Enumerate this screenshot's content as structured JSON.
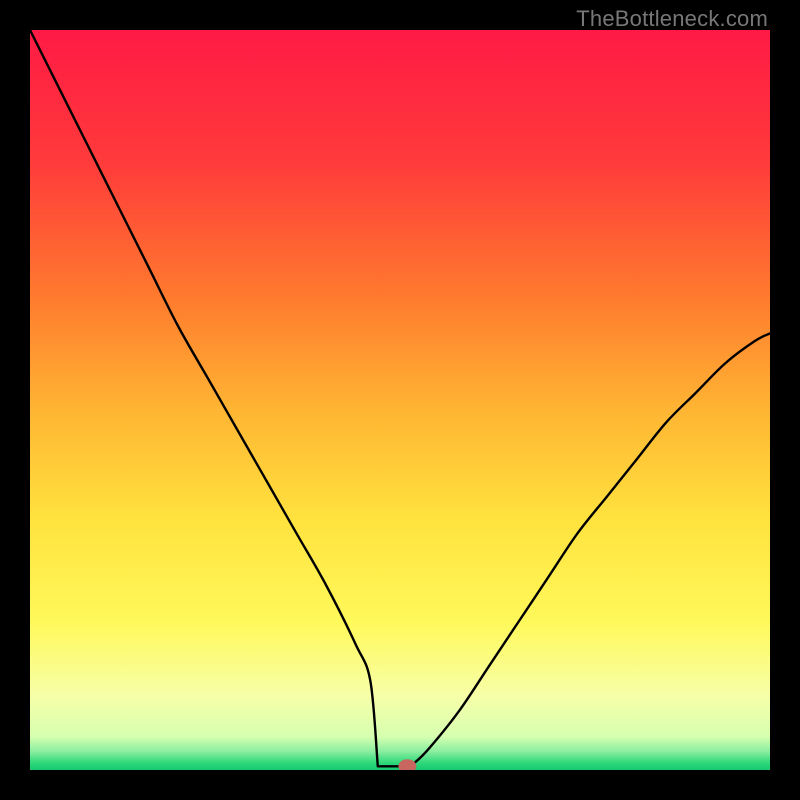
{
  "attribution": "TheBottleneck.com",
  "chart_data": {
    "type": "line",
    "title": "",
    "xlabel": "",
    "ylabel": "",
    "xlim": [
      0,
      100
    ],
    "ylim": [
      0,
      100
    ],
    "background": {
      "type": "vertical-gradient",
      "stops": [
        {
          "pos": 0.0,
          "color": "#ff1a45"
        },
        {
          "pos": 0.18,
          "color": "#ff3b3b"
        },
        {
          "pos": 0.36,
          "color": "#ff7a2e"
        },
        {
          "pos": 0.52,
          "color": "#ffb733"
        },
        {
          "pos": 0.66,
          "color": "#ffe23e"
        },
        {
          "pos": 0.8,
          "color": "#fff95a"
        },
        {
          "pos": 0.9,
          "color": "#f7ffa8"
        },
        {
          "pos": 0.955,
          "color": "#d6ffb0"
        },
        {
          "pos": 0.975,
          "color": "#8beea0"
        },
        {
          "pos": 0.99,
          "color": "#2fd97a"
        },
        {
          "pos": 1.0,
          "color": "#17c873"
        }
      ]
    },
    "series": [
      {
        "name": "bottleneck-curve",
        "color": "#000000",
        "x": [
          0,
          4,
          8,
          12,
          16,
          20,
          24,
          28,
          32,
          36,
          40,
          44,
          46,
          48,
          49,
          50,
          51,
          52,
          54,
          58,
          62,
          66,
          70,
          74,
          78,
          82,
          86,
          90,
          94,
          98,
          100
        ],
        "y": [
          100,
          92,
          84,
          76,
          68,
          60,
          53,
          46,
          39,
          32,
          25,
          17,
          12,
          6,
          2,
          0,
          0,
          1,
          3,
          8,
          14,
          20,
          26,
          32,
          37,
          42,
          47,
          51,
          55,
          58,
          59
        ],
        "flat_segment": {
          "from_x": 47,
          "to_x": 51,
          "y": 0.5
        }
      }
    ],
    "marker": {
      "x": 51,
      "y": 0.5,
      "color": "#c9665f",
      "rx": 9,
      "ry": 7
    }
  }
}
